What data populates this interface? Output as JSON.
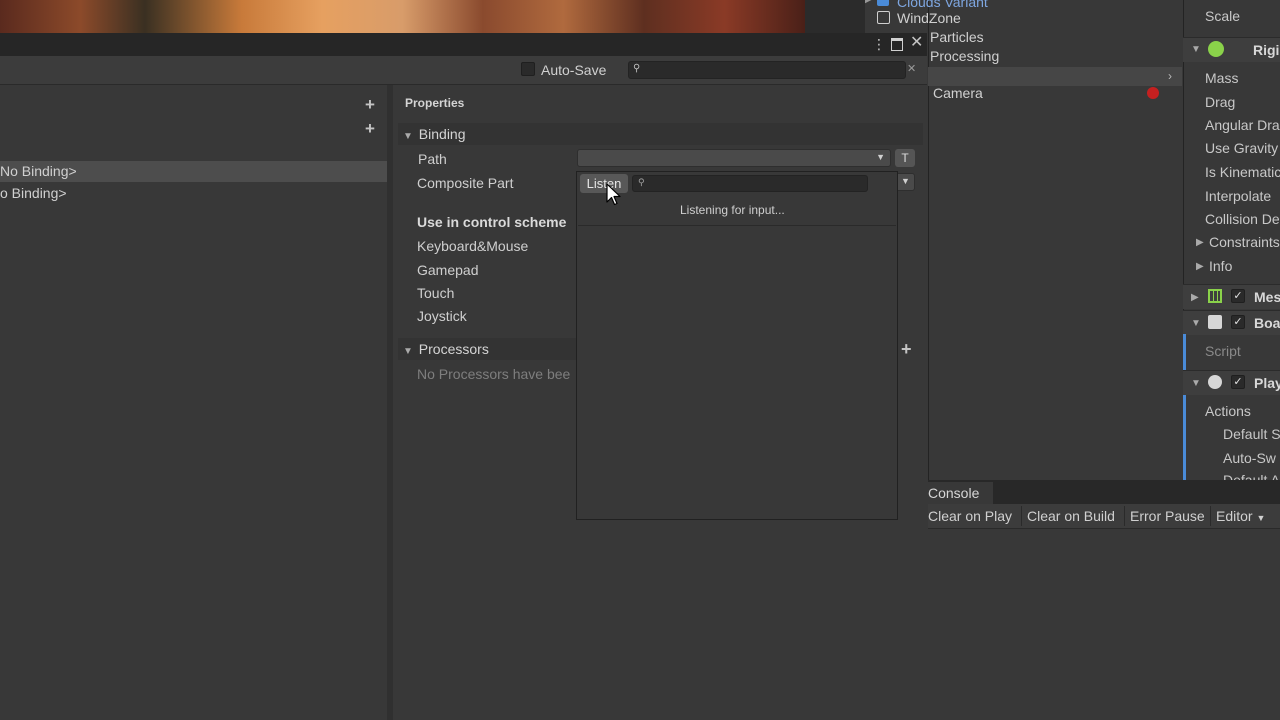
{
  "window": {
    "auto_save_label": "Auto-Save",
    "search_placeholder": ""
  },
  "maps": {
    "bindings": [
      {
        "label": "No Binding>",
        "selected": true
      },
      {
        "label": "o Binding>",
        "selected": false
      }
    ]
  },
  "properties": {
    "header": "Properties",
    "binding_section": "Binding",
    "path_label": "Path",
    "path_t_label": "T",
    "composite_part_label": "Composite Part",
    "control_scheme_heading": "Use in control scheme",
    "schemes": [
      "Keyboard&Mouse",
      "Gamepad",
      "Touch",
      "Joystick"
    ],
    "processors_section": "Processors",
    "no_processors_text": "No Processors have bee"
  },
  "popup": {
    "listen_label": "Listen",
    "listening_text": "Listening for input..."
  },
  "hierarchy": {
    "items": [
      "Clouds Variant",
      "WindZone",
      "Particles",
      "Processing",
      "Camera"
    ]
  },
  "inspector": {
    "scale_label": "Scale",
    "rigidbody_title": "Rigi",
    "rigidbody_props": [
      "Mass",
      "Drag",
      "Angular Dra",
      "Use Gravity",
      "Is Kinematic",
      "Interpolate",
      "Collision De"
    ],
    "constraints_label": "Constraints",
    "info_label": "Info",
    "mesh_title": "Mes",
    "board_title": "Boa",
    "script_label": "Script",
    "player_title": "Play",
    "actions_label": "Actions",
    "default_scheme_label": "Default S",
    "auto_switch_label": "Auto-Sw",
    "default_action_label": "Default A"
  },
  "console": {
    "tab_label": "Console",
    "buttons": [
      "Clear on Play",
      "Clear on Build",
      "Error Pause",
      "Editor"
    ]
  },
  "colors": {
    "background": "#383838",
    "selected_row": "#4d4d4d",
    "accent_blue": "#4a8bd8"
  }
}
